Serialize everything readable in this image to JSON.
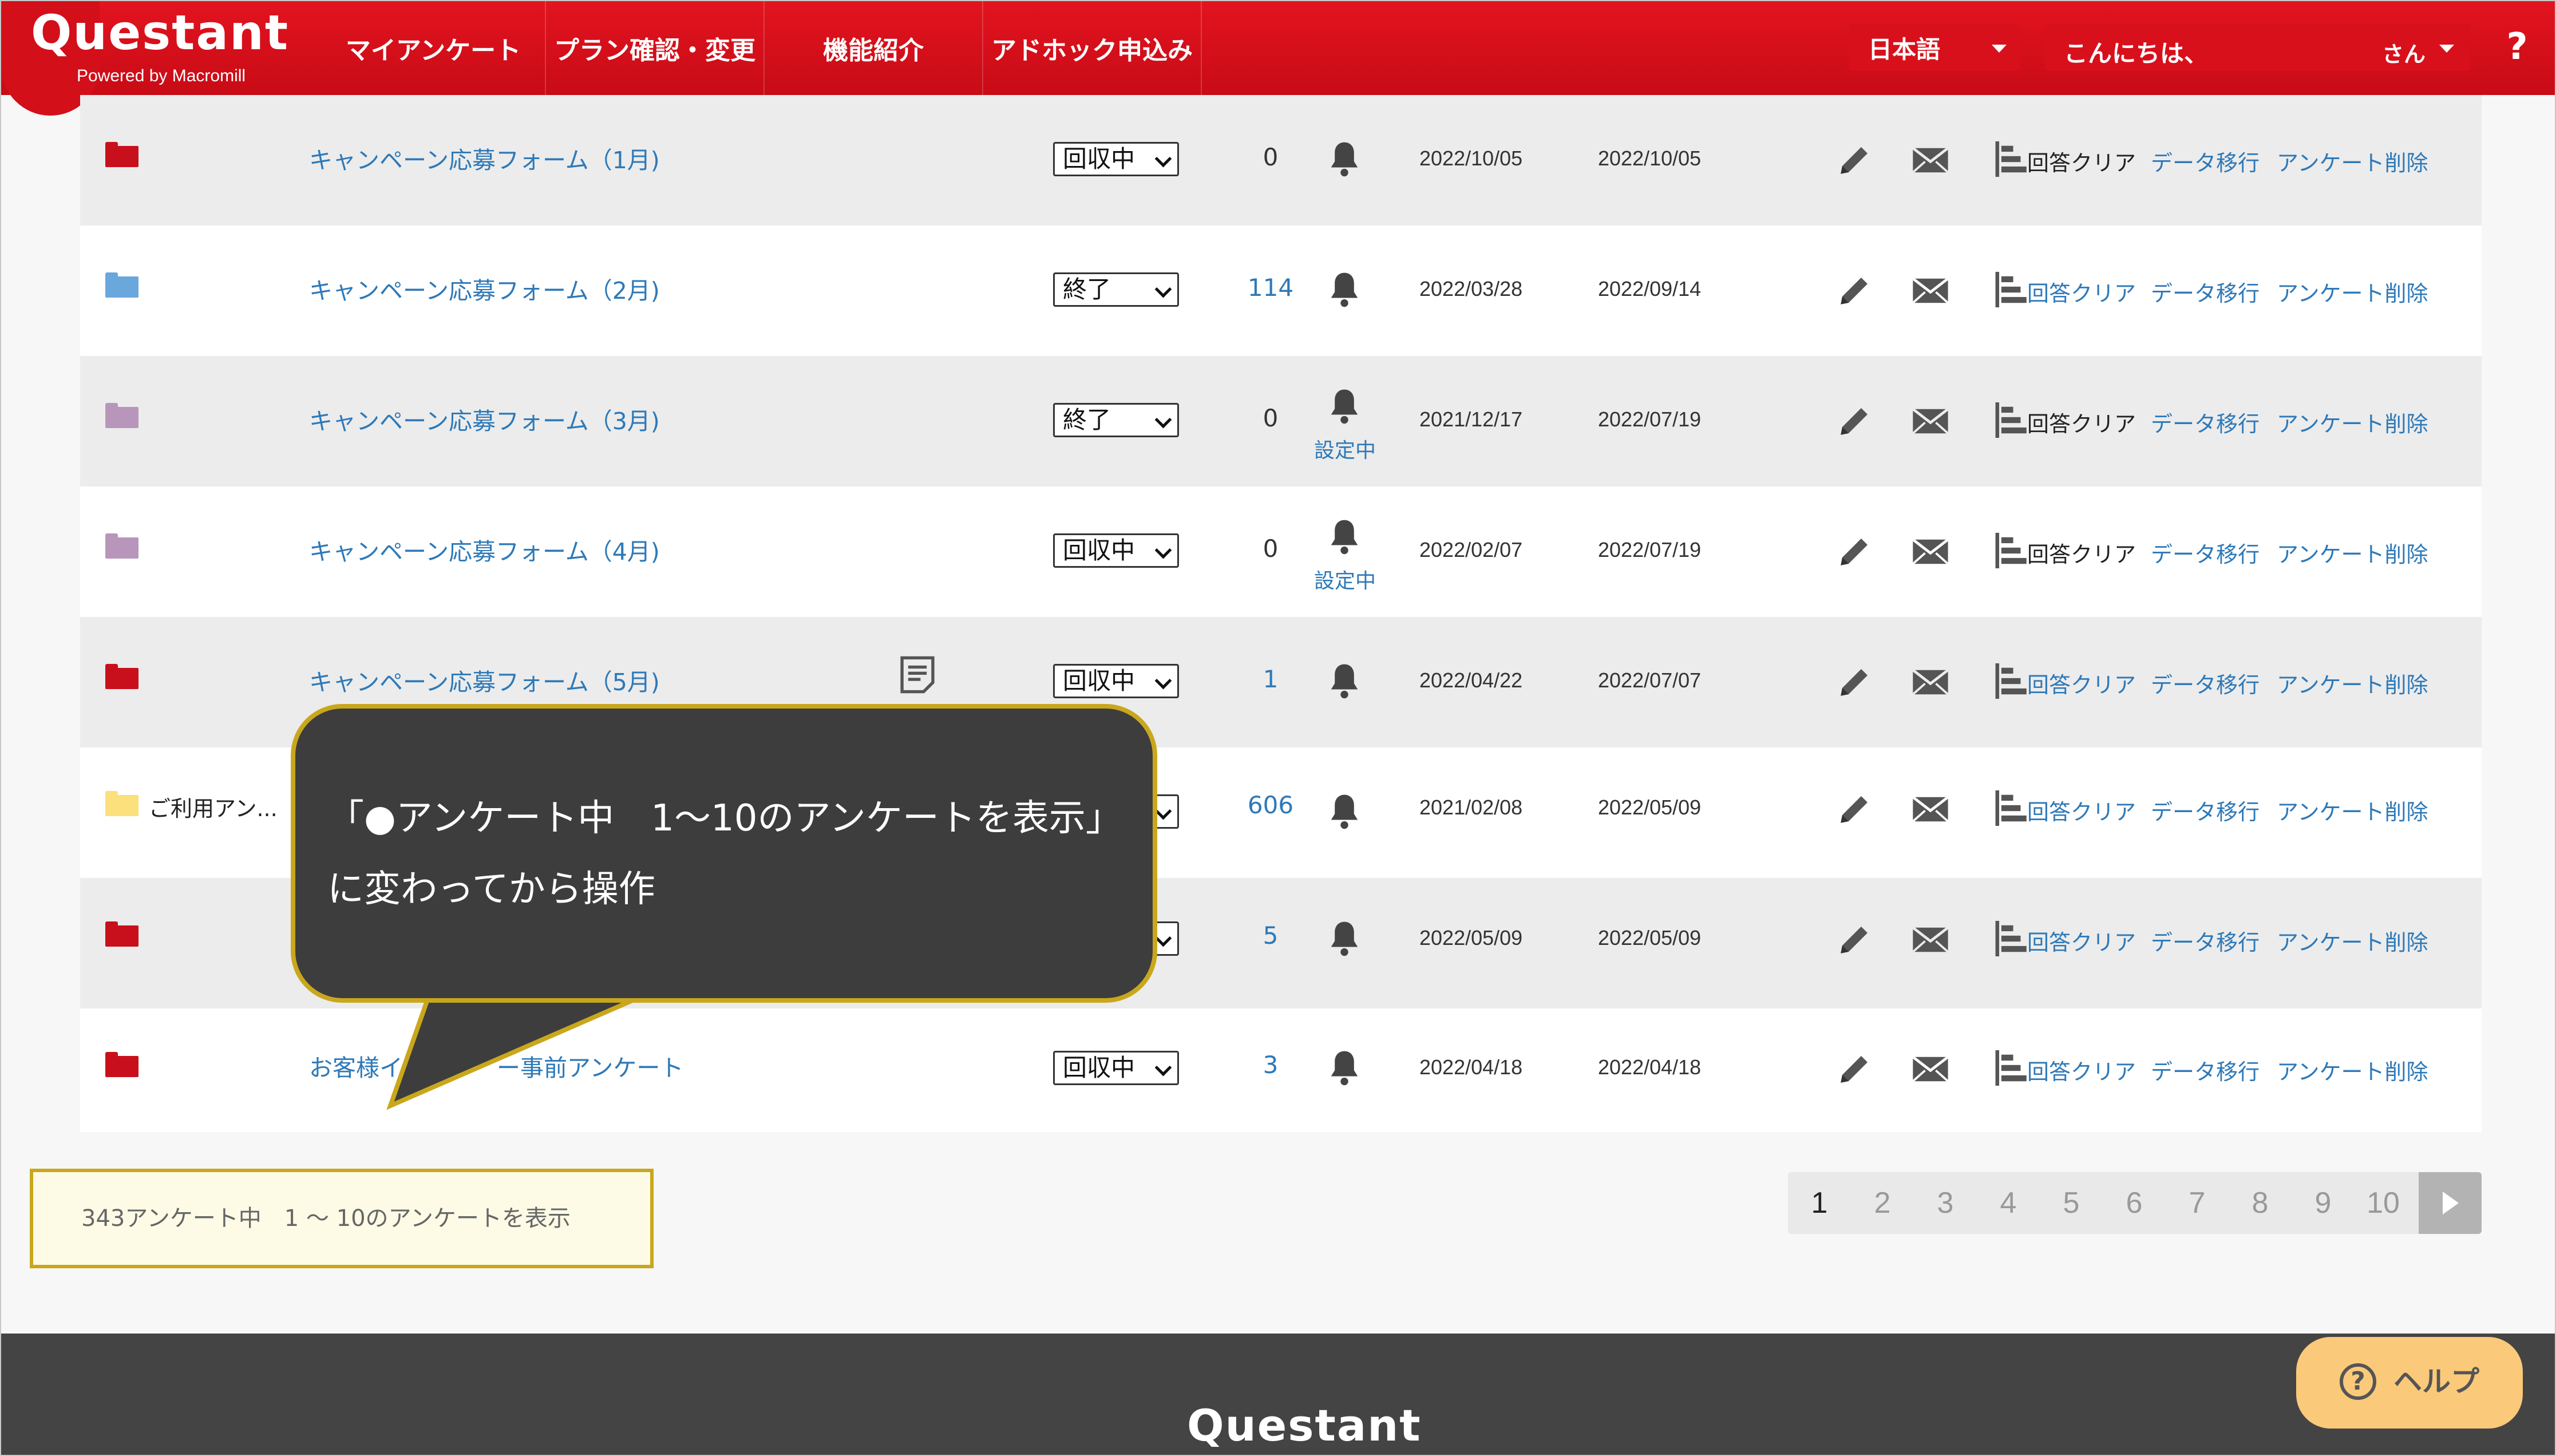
{
  "header": {
    "logo": "Questant",
    "logo_sub": "Powered by Macromill",
    "nav": [
      "マイアンケート",
      "プラン確認・変更",
      "機能紹介",
      "アドホック申込み"
    ],
    "language": "日本語",
    "greeting_prefix": "こんにちは、",
    "greeting_suffix": "さん",
    "help_mark": "?"
  },
  "rows": [
    {
      "title": "キャンペーン応募フォーム（1月)",
      "folder_color": "#c8101c",
      "status": "回収中",
      "count": "0",
      "count_link": false,
      "notice_setting": "",
      "created": "2022/10/05",
      "updated": "2022/10/05",
      "clear": "回答クリア",
      "clear_link": false,
      "migrate": "データ移行",
      "delete": "アンケート削除"
    },
    {
      "title": "キャンペーン応募フォーム（2月)",
      "folder_color": "#6aa7dd",
      "status": "終了",
      "count": "114",
      "count_link": true,
      "notice_setting": "",
      "created": "2022/03/28",
      "updated": "2022/09/14",
      "clear": "回答クリア",
      "clear_link": true,
      "migrate": "データ移行",
      "delete": "アンケート削除"
    },
    {
      "title": "キャンペーン応募フォーム（3月)",
      "folder_color": "#b896bb",
      "status": "終了",
      "count": "0",
      "count_link": false,
      "notice_setting": "設定中",
      "created": "2021/12/17",
      "updated": "2022/07/19",
      "clear": "回答クリア",
      "clear_link": false,
      "migrate": "データ移行",
      "delete": "アンケート削除"
    },
    {
      "title": "キャンペーン応募フォーム（4月)",
      "folder_color": "#b896bb",
      "status": "回収中",
      "count": "0",
      "count_link": false,
      "notice_setting": "設定中",
      "created": "2022/02/07",
      "updated": "2022/07/19",
      "clear": "回答クリア",
      "clear_link": false,
      "migrate": "データ移行",
      "delete": "アンケート削除"
    },
    {
      "title": "キャンペーン応募フォーム（5月)",
      "folder_color": "#c8101c",
      "status": "回収中",
      "count": "1",
      "count_link": true,
      "notice_setting": "",
      "created": "2022/04/22",
      "updated": "2022/07/07",
      "clear": "回答クリア",
      "clear_link": true,
      "migrate": "データ移行",
      "delete": "アンケート削除"
    },
    {
      "title": "ご利用アン...",
      "folder_color": "#fbe07b",
      "status": "",
      "count": "606",
      "count_link": true,
      "notice_setting": "",
      "created": "2021/02/08",
      "updated": "2022/05/09",
      "clear": "回答クリア",
      "clear_link": true,
      "migrate": "データ移行",
      "delete": "アンケート削除"
    },
    {
      "title": "",
      "folder_color": "#c8101c",
      "status": "",
      "count": "5",
      "count_link": true,
      "notice_setting": "",
      "created": "2022/05/09",
      "updated": "2022/05/09",
      "clear": "回答クリア",
      "clear_link": true,
      "migrate": "データ移行",
      "delete": "アンケート削除"
    },
    {
      "title": "お客様イ　　　　ー事前アンケート",
      "folder_color": "#c8101c",
      "status": "回収中",
      "count": "3",
      "count_link": true,
      "notice_setting": "",
      "created": "2022/04/18",
      "updated": "2022/04/18",
      "clear": "回答クリア",
      "clear_link": true,
      "migrate": "データ移行",
      "delete": "アンケート削除"
    }
  ],
  "summary": "343アンケート中　1 ～ 10のアンケートを表示",
  "pagination": {
    "pages": [
      "1",
      "2",
      "3",
      "4",
      "5",
      "6",
      "7",
      "8",
      "9",
      "10"
    ],
    "current": "1"
  },
  "callout": {
    "line1": "「●アンケート中　1～10のアンケートを表示」",
    "line2": "に変わってから操作"
  },
  "footer": {
    "logo": "Questant"
  },
  "help_button": {
    "icon": "?",
    "label": "ヘルプ"
  },
  "colors": {
    "brand_red": "#d30f1a",
    "link_blue": "#2e79b8",
    "callout_border": "#c9a71c",
    "help_button": "#fbc97a"
  }
}
